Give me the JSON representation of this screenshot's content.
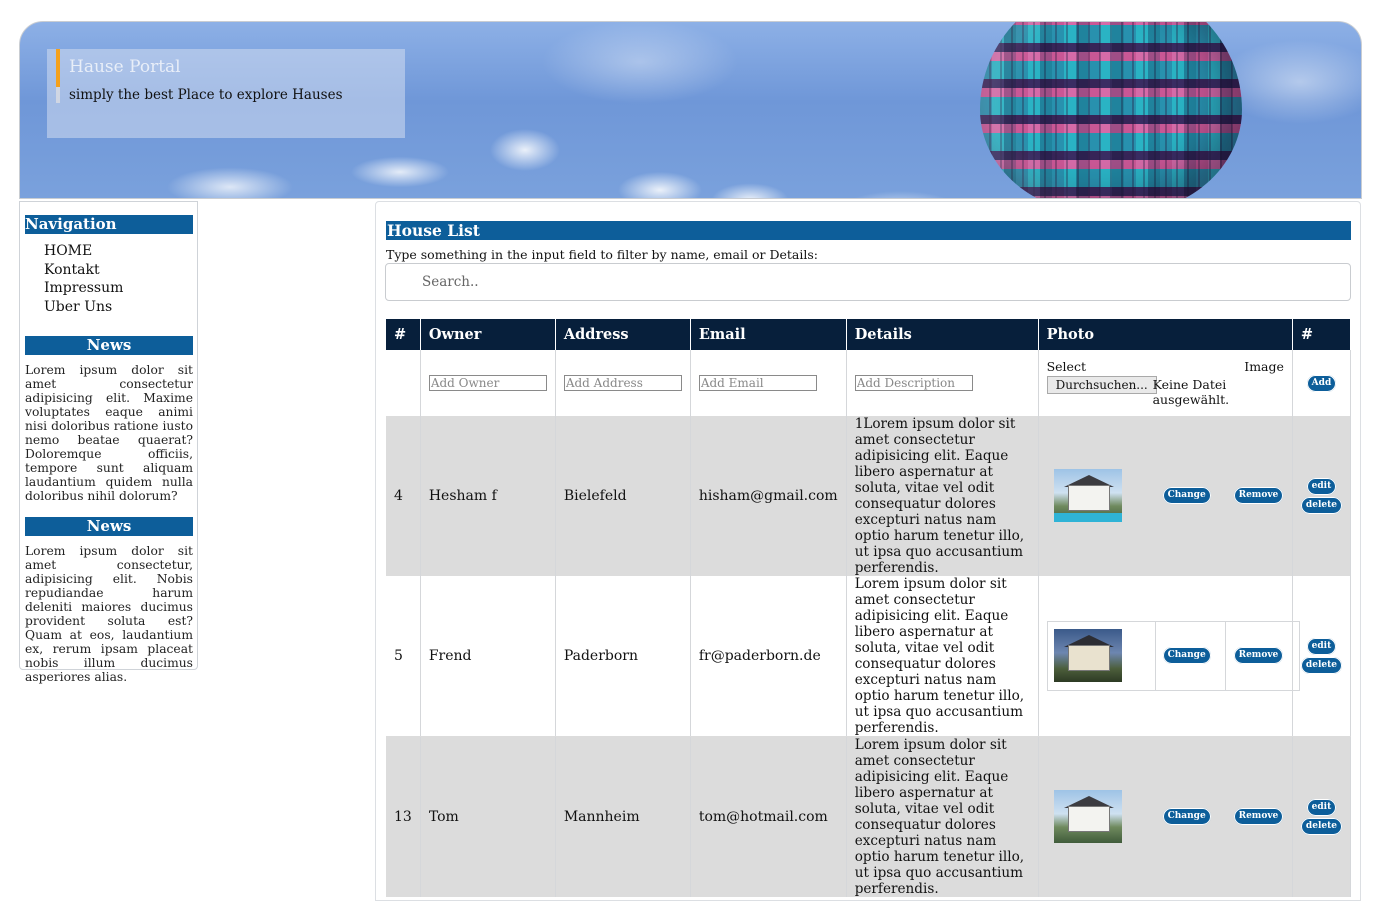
{
  "header": {
    "site_title": "Hause Portal",
    "slogan": "simply the best Place to explore Hauses"
  },
  "sidebar": {
    "nav_heading": "Navigation",
    "nav_items": [
      {
        "label": "HOME"
      },
      {
        "label": "Kontakt"
      },
      {
        "label": "Impressum"
      },
      {
        "label": "Uber Uns"
      }
    ],
    "news": [
      {
        "heading": "News",
        "text": "Lorem ipsum dolor sit amet consectetur adipisicing elit. Maxime voluptates eaque animi nisi doloribus ratione iusto nemo beatae quaerat? Doloremque officiis, tempore sunt aliquam laudantium quidem nulla doloribus nihil dolorum?"
      },
      {
        "heading": "News",
        "text": "Lorem ipsum dolor sit amet consectetur, adipisicing elit. Nobis repudiandae harum deleniti maiores ducimus provident soluta est? Quam at eos, laudantium ex, rerum ipsam placeat nobis illum ducimus asperiores alias."
      }
    ]
  },
  "main": {
    "heading": "House List",
    "filter_hint": "Type something in the input field to filter by name, email or Details:",
    "search_placeholder": "Search..",
    "columns": [
      "#",
      "Owner",
      "Address",
      "Email",
      "Details",
      "Photo",
      "#"
    ],
    "add_row": {
      "owner_placeholder": "Add Owner",
      "address_placeholder": "Add Address",
      "email_placeholder": "Add Email",
      "description_placeholder": "Add Description",
      "select_label": "Select",
      "image_label": "Image",
      "browse_label": "Durchsuchen...",
      "no_file_label": "Keine Datei ausgewählt.",
      "add_label": "Add"
    },
    "rows": [
      {
        "id": "4",
        "owner": "Hesham f",
        "address": "Bielefeld",
        "email": "hisham@gmail.com",
        "details": "1Lorem ipsum dolor sit amet consectetur adipisicing elit. Eaque libero aspernatur at soluta, vitae vel odit consequatur dolores excepturi natus nam optio harum tenetur illo, ut ipsa quo accusantium perferendis."
      },
      {
        "id": "5",
        "owner": "Frend",
        "address": "Paderborn",
        "email": "fr@paderborn.de",
        "details": "Lorem ipsum dolor sit amet consectetur adipisicing elit. Eaque libero aspernatur at soluta, vitae vel odit consequatur dolores excepturi natus nam optio harum tenetur illo, ut ipsa quo accusantium perferendis."
      },
      {
        "id": "13",
        "owner": "Tom",
        "address": "Mannheim",
        "email": "tom@hotmail.com",
        "details": "Lorem ipsum dolor sit amet consectetur adipisicing elit. Eaque libero aspernatur at soluta, vitae vel odit consequatur dolores excepturi natus nam optio harum tenetur illo, ut ipsa quo accusantium perferendis."
      }
    ],
    "row_actions": {
      "change_label": "Change",
      "remove_label": "Remove",
      "edit_label": "edit",
      "delete_label": "delete"
    }
  },
  "colors": {
    "accent": "#0d5e9a",
    "table_header": "#071f3b",
    "row_grey": "#dcdcdc",
    "title_bar": "#f5a11c"
  }
}
